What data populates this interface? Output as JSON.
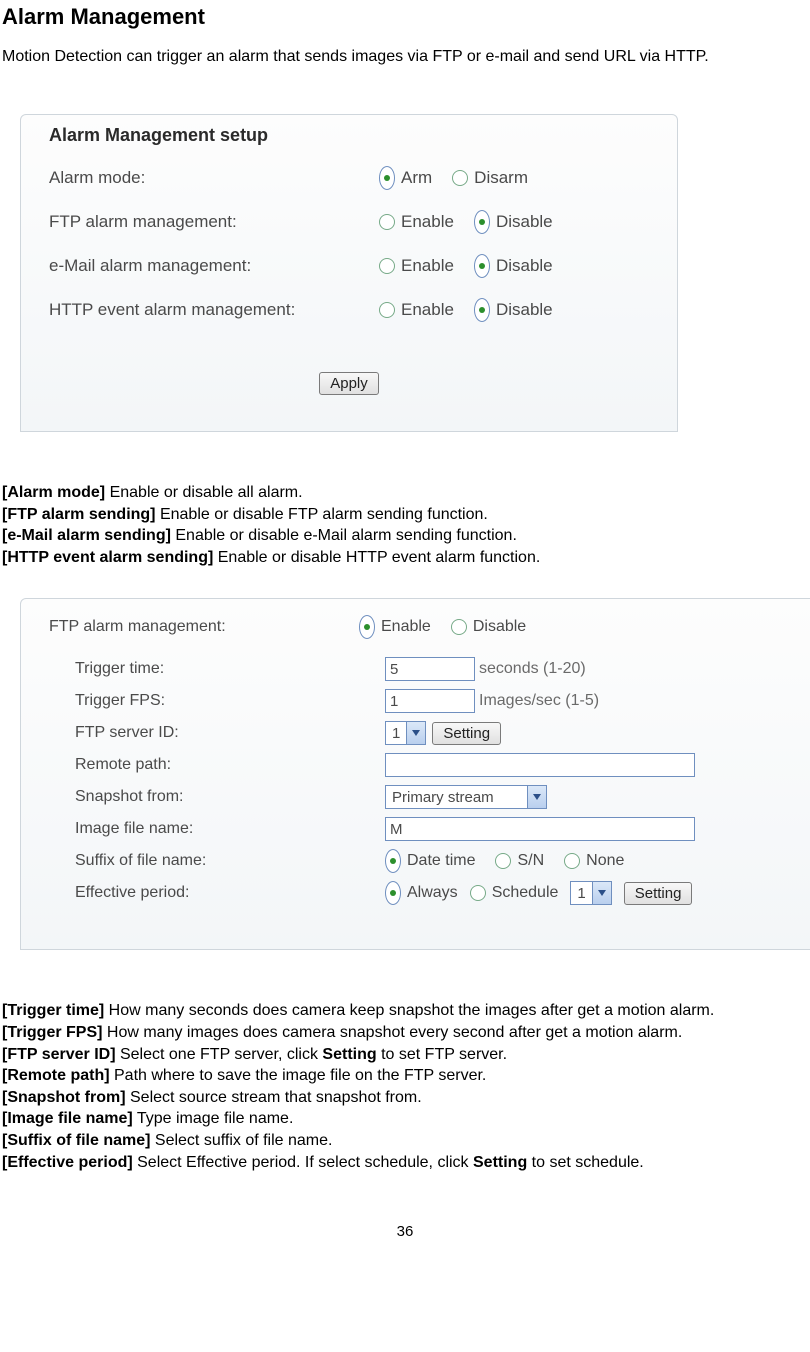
{
  "page": {
    "title": "Alarm Management",
    "intro": "Motion Detection can trigger an alarm that sends images via FTP or e-mail and send URL via HTTP.",
    "page_number": "36"
  },
  "panel1": {
    "title": "Alarm Management setup",
    "rows": {
      "alarm_mode": {
        "label": "Alarm mode:",
        "opt1": "Arm",
        "opt2": "Disarm"
      },
      "ftp": {
        "label": "FTP alarm management:",
        "opt1": "Enable",
        "opt2": "Disable"
      },
      "email": {
        "label": "e-Mail alarm management:",
        "opt1": "Enable",
        "opt2": "Disable"
      },
      "http": {
        "label": "HTTP event alarm management:",
        "opt1": "Enable",
        "opt2": "Disable"
      }
    },
    "apply": "Apply"
  },
  "defs1": {
    "l1b": "[Alarm mode]",
    "l1t": " Enable or disable all alarm.",
    "l2b": "[FTP alarm sending]",
    "l2t": " Enable or disable FTP alarm sending function.",
    "l3b": "[e-Mail alarm sending]",
    "l3t": " Enable or disable e-Mail alarm sending function.",
    "l4b": "[HTTP event alarm sending]",
    "l4t": " Enable or disable HTTP event alarm function."
  },
  "panel2": {
    "header": {
      "label": "FTP alarm management:",
      "opt1": "Enable",
      "opt2": "Disable"
    },
    "trigger_time": {
      "label": "Trigger time:",
      "value": "5",
      "hint": "seconds (1-20)"
    },
    "trigger_fps": {
      "label": "Trigger FPS:",
      "value": "1",
      "hint": "Images/sec (1-5)"
    },
    "ftp_id": {
      "label": "FTP server ID:",
      "value": "1",
      "setting": "Setting"
    },
    "remote_path": {
      "label": "Remote path:",
      "value": ""
    },
    "snapshot_from": {
      "label": "Snapshot from:",
      "value": "Primary stream"
    },
    "image_file": {
      "label": "Image file name:",
      "value": "M"
    },
    "suffix": {
      "label": "Suffix of file name:",
      "opt1": "Date time",
      "opt2": "S/N",
      "opt3": "None"
    },
    "effective": {
      "label": "Effective period:",
      "opt1": "Always",
      "opt2": "Schedule",
      "sched_value": "1",
      "setting": "Setting"
    }
  },
  "defs2": {
    "l1b": "[Trigger time]",
    "l1t": " How many seconds does camera keep snapshot the images after get a motion alarm.",
    "l2b": "[Trigger FPS]",
    "l2t": " How many images does camera snapshot every second after get a motion alarm.",
    "l3b": "[FTP server ID]",
    "l3t1": " Select one FTP server, click ",
    "l3s": "Setting",
    "l3t2": " to set FTP server.",
    "l4b": "[Remote path]",
    "l4t": " Path where to save the image file on the FTP server.",
    "l5b": "[Snapshot from]",
    "l5t": " Select source stream that snapshot from.",
    "l6b": "[Image file name]",
    "l6t": " Type image file name.",
    "l7b": "[Suffix of file name]",
    "l7t": " Select suffix of file name.",
    "l8b": "[Effective period]",
    "l8t1": " Select Effective period. If select schedule, click ",
    "l8s": "Setting",
    "l8t2": " to set schedule."
  }
}
